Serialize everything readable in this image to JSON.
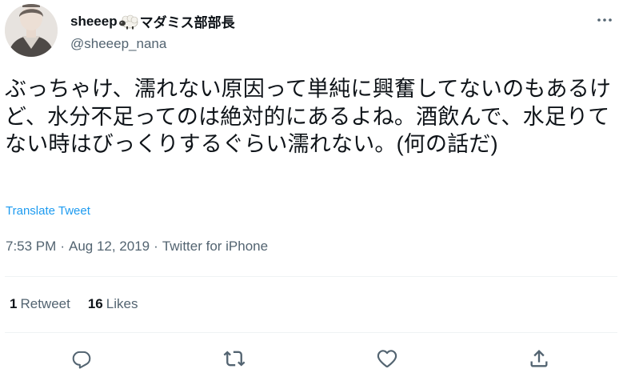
{
  "author": {
    "display_name_prefix": "sheeep",
    "display_name_suffix": "マダミス部部長",
    "handle": "@sheeep_nana"
  },
  "tweet": {
    "text": "ぶっちゃけ、濡れない原因って単純に興奮してないのもあるけど、水分不足ってのは絶対的にあるよね。酒飲んで、水足りてない時はびっくりするぐらい濡れない。(何の話だ)",
    "translate_label": "Translate Tweet",
    "time": "7:53 PM",
    "separator": "·",
    "date": "Aug 12, 2019",
    "source": "Twitter for iPhone"
  },
  "stats": {
    "retweets_count": "1",
    "retweets_label": "Retweet",
    "likes_count": "16",
    "likes_label": "Likes"
  },
  "icons": {
    "more": "more-options-icon",
    "reply": "reply-icon",
    "retweet": "retweet-icon",
    "like": "like-icon",
    "share": "share-icon"
  },
  "colors": {
    "text": "#0f1419",
    "secondary": "#536471",
    "link": "#1d9bf0",
    "divider": "#eff3f4"
  }
}
